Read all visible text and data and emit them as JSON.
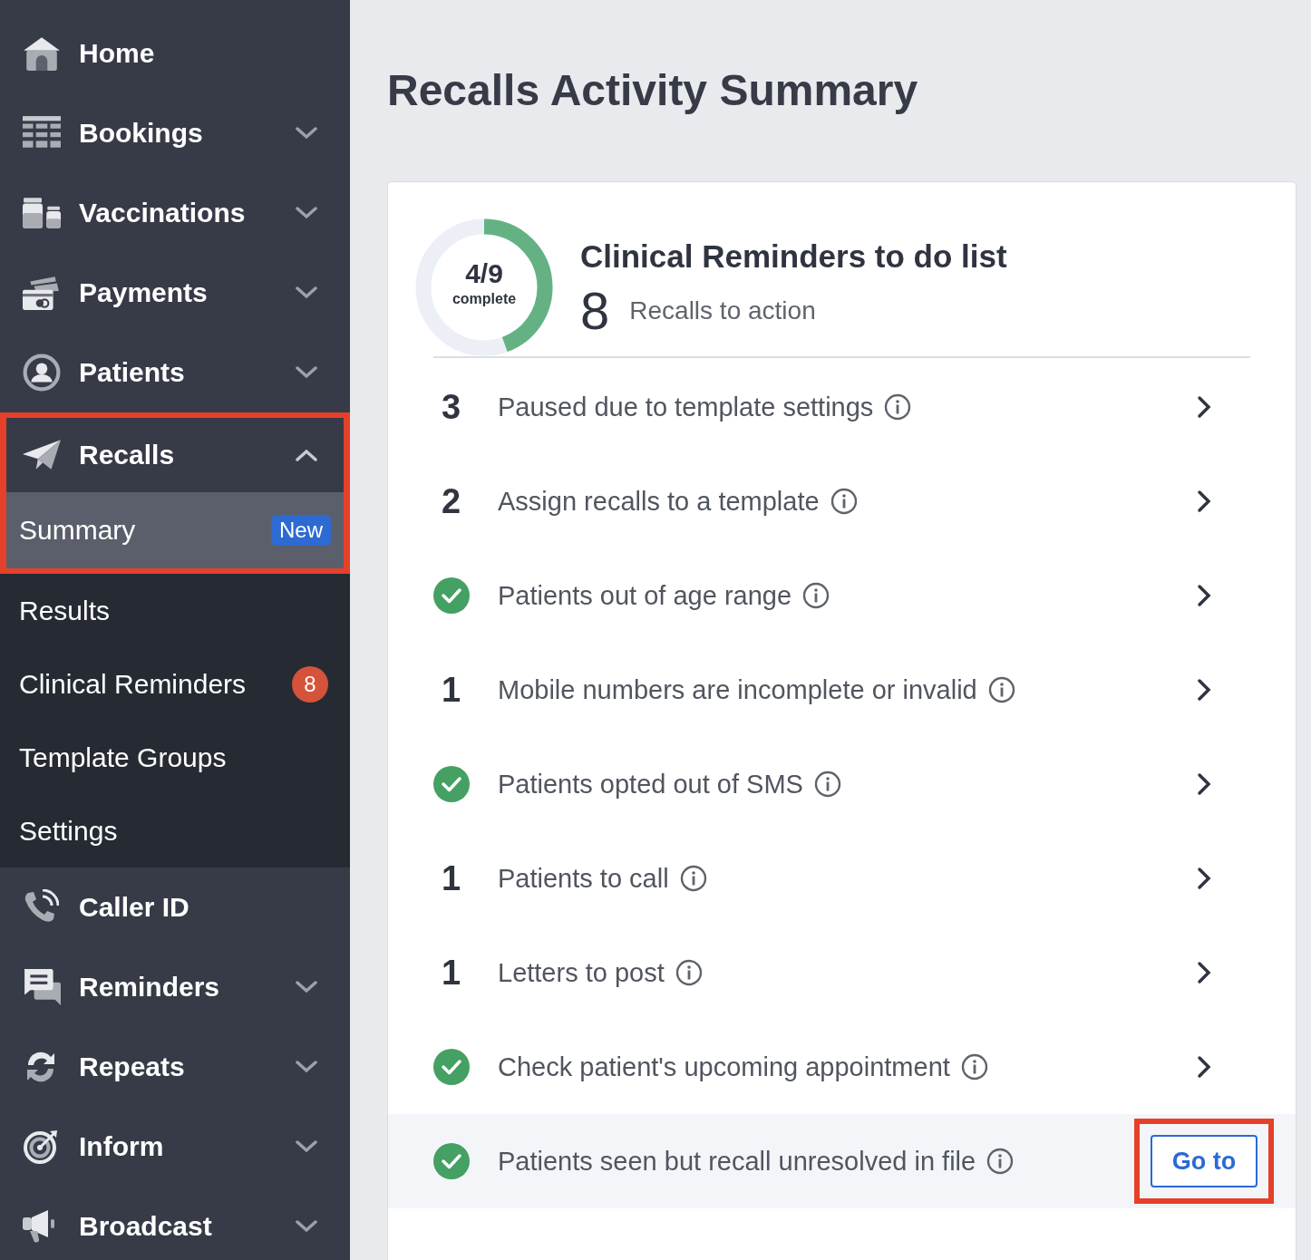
{
  "sidebar": {
    "items": [
      {
        "kind": "link",
        "label": "Home"
      },
      {
        "kind": "menu",
        "label": "Bookings",
        "expanded": false
      },
      {
        "kind": "menu",
        "label": "Vaccinations",
        "expanded": false
      },
      {
        "kind": "menu",
        "label": "Payments",
        "expanded": false
      },
      {
        "kind": "menu",
        "label": "Patients",
        "expanded": false
      },
      {
        "kind": "menu",
        "label": "Recalls",
        "expanded": true,
        "highlighted": true,
        "children": [
          {
            "label": "Summary",
            "selected": true,
            "badge": {
              "text": "New",
              "color": "#2d6ad3"
            }
          },
          {
            "label": "Results",
            "selected": false
          },
          {
            "label": "Clinical Reminders",
            "selected": false,
            "badge": {
              "text": "8",
              "color": "#d4533a"
            }
          },
          {
            "label": "Template Groups",
            "selected": false
          },
          {
            "label": "Settings",
            "selected": false
          }
        ]
      },
      {
        "kind": "link",
        "label": "Caller ID"
      },
      {
        "kind": "menu",
        "label": "Reminders",
        "expanded": false
      },
      {
        "kind": "menu",
        "label": "Repeats",
        "expanded": false
      },
      {
        "kind": "menu",
        "label": "Inform",
        "expanded": false
      },
      {
        "kind": "menu",
        "label": "Broadcast",
        "expanded": false
      }
    ]
  },
  "page": {
    "title": "Recalls Activity Summary"
  },
  "summary": {
    "progress": {
      "level": 0.444,
      "fraction": "4/9",
      "caption": "complete"
    },
    "heading": "Clinical Reminders to do list",
    "count": "8",
    "count_label": "Recalls to action"
  },
  "tasks": [
    {
      "kind": "count",
      "count": "3",
      "label": "Paused due to template settings",
      "hovered": false
    },
    {
      "kind": "count",
      "count": "2",
      "label": "Assign recalls to a template",
      "hovered": false
    },
    {
      "kind": "done",
      "label": "Patients out of age range",
      "hovered": false
    },
    {
      "kind": "count",
      "count": "1",
      "label": "Mobile numbers are incomplete or invalid",
      "hovered": false
    },
    {
      "kind": "done",
      "label": "Patients opted out of SMS",
      "hovered": false
    },
    {
      "kind": "count",
      "count": "1",
      "label": "Patients to call",
      "hovered": false
    },
    {
      "kind": "count",
      "count": "1",
      "label": "Letters to post",
      "hovered": false
    },
    {
      "kind": "done",
      "label": "Check patient's upcoming appointment",
      "hovered": false
    },
    {
      "kind": "done",
      "label": "Patients seen but recall unresolved in file",
      "hovered": true,
      "button": "Go to",
      "button_highlighted": true
    }
  ]
}
